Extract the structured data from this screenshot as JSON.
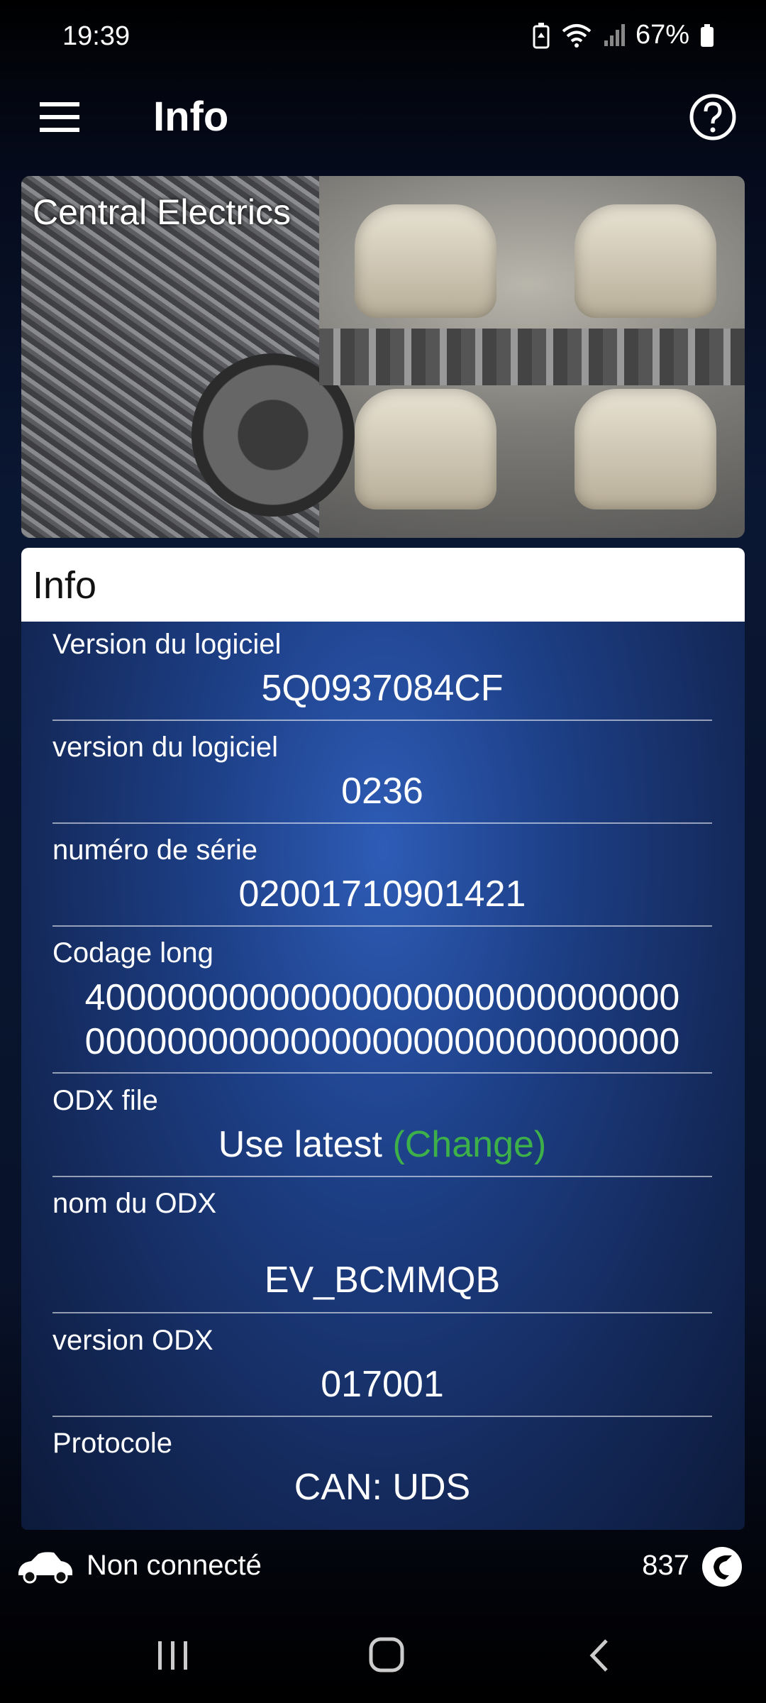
{
  "status_bar": {
    "time": "19:39",
    "battery": "67%"
  },
  "toolbar": {
    "title": "Info"
  },
  "banner": {
    "label": "Central Electrics"
  },
  "card": {
    "header": "Info",
    "rows": [
      {
        "label": "Version du logiciel",
        "value": "5Q0937084CF"
      },
      {
        "label": "version du logiciel",
        "value": "0236"
      },
      {
        "label": "numéro de série",
        "value": "02001710901421"
      },
      {
        "label": "Codage long",
        "value_line1": "40000000000000000000000000000",
        "value_line2": "00000000000000000000000000000"
      },
      {
        "label": "ODX file",
        "value": "Use latest",
        "link": "(Change)"
      },
      {
        "label": "nom du ODX",
        "value": "EV_BCMMQB"
      },
      {
        "label": "version ODX",
        "value": "017001"
      },
      {
        "label": "Protocole",
        "value": "CAN: UDS"
      }
    ]
  },
  "bottom_status": {
    "connection": "Non connecté",
    "count": "837"
  },
  "colors": {
    "link_green": "#3db04a",
    "card_blue": "#1d3f86"
  },
  "icons": [
    "menu-icon",
    "help-icon",
    "car-icon",
    "app-logo-icon",
    "recents-icon",
    "home-icon",
    "back-icon"
  ]
}
